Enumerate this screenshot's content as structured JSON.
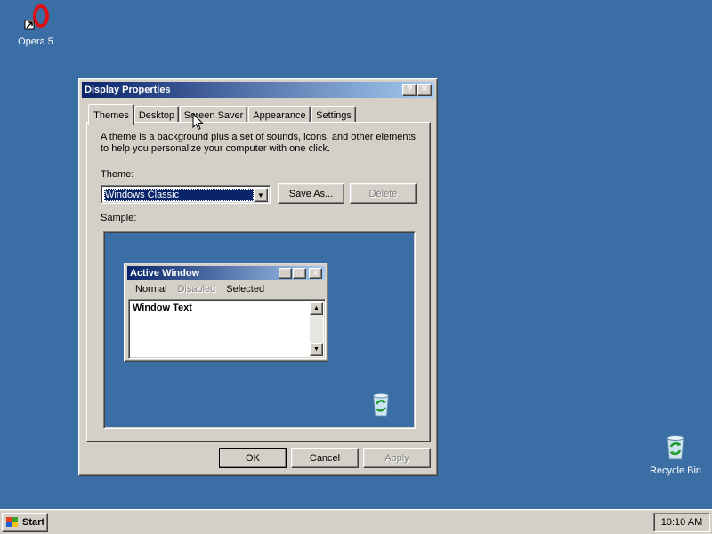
{
  "desktop": {
    "icons": [
      {
        "label": "Opera 5",
        "icon": "opera-icon"
      },
      {
        "label": "Recycle Bin",
        "icon": "recycle-bin-icon"
      }
    ],
    "background_color": "#3a6ea5"
  },
  "dialog": {
    "title": "Display Properties",
    "help_button": "?",
    "close_button": "✕",
    "tabs": [
      {
        "label": "Themes",
        "selected": true
      },
      {
        "label": "Desktop"
      },
      {
        "label": "Screen Saver"
      },
      {
        "label": "Appearance"
      },
      {
        "label": "Settings"
      }
    ],
    "description": "A theme is a background plus a set of sounds, icons, and other elements to help you personalize your computer with one click.",
    "theme_label": "Theme:",
    "theme_value": "Windows Classic",
    "save_as_label": "Save As...",
    "delete_label": "Delete",
    "sample_label": "Sample:",
    "sample": {
      "window_title": "Active Window",
      "menu": {
        "normal": "Normal",
        "disabled": "Disabled",
        "selected": "Selected"
      },
      "window_text": "Window Text"
    },
    "ok_label": "OK",
    "cancel_label": "Cancel",
    "apply_label": "Apply"
  },
  "taskbar": {
    "start_label": "Start",
    "clock": "10:10 AM"
  },
  "colors": {
    "title_active_start": "#0a246a",
    "title_active_end": "#a6caf0",
    "face": "#d4d0c8"
  }
}
